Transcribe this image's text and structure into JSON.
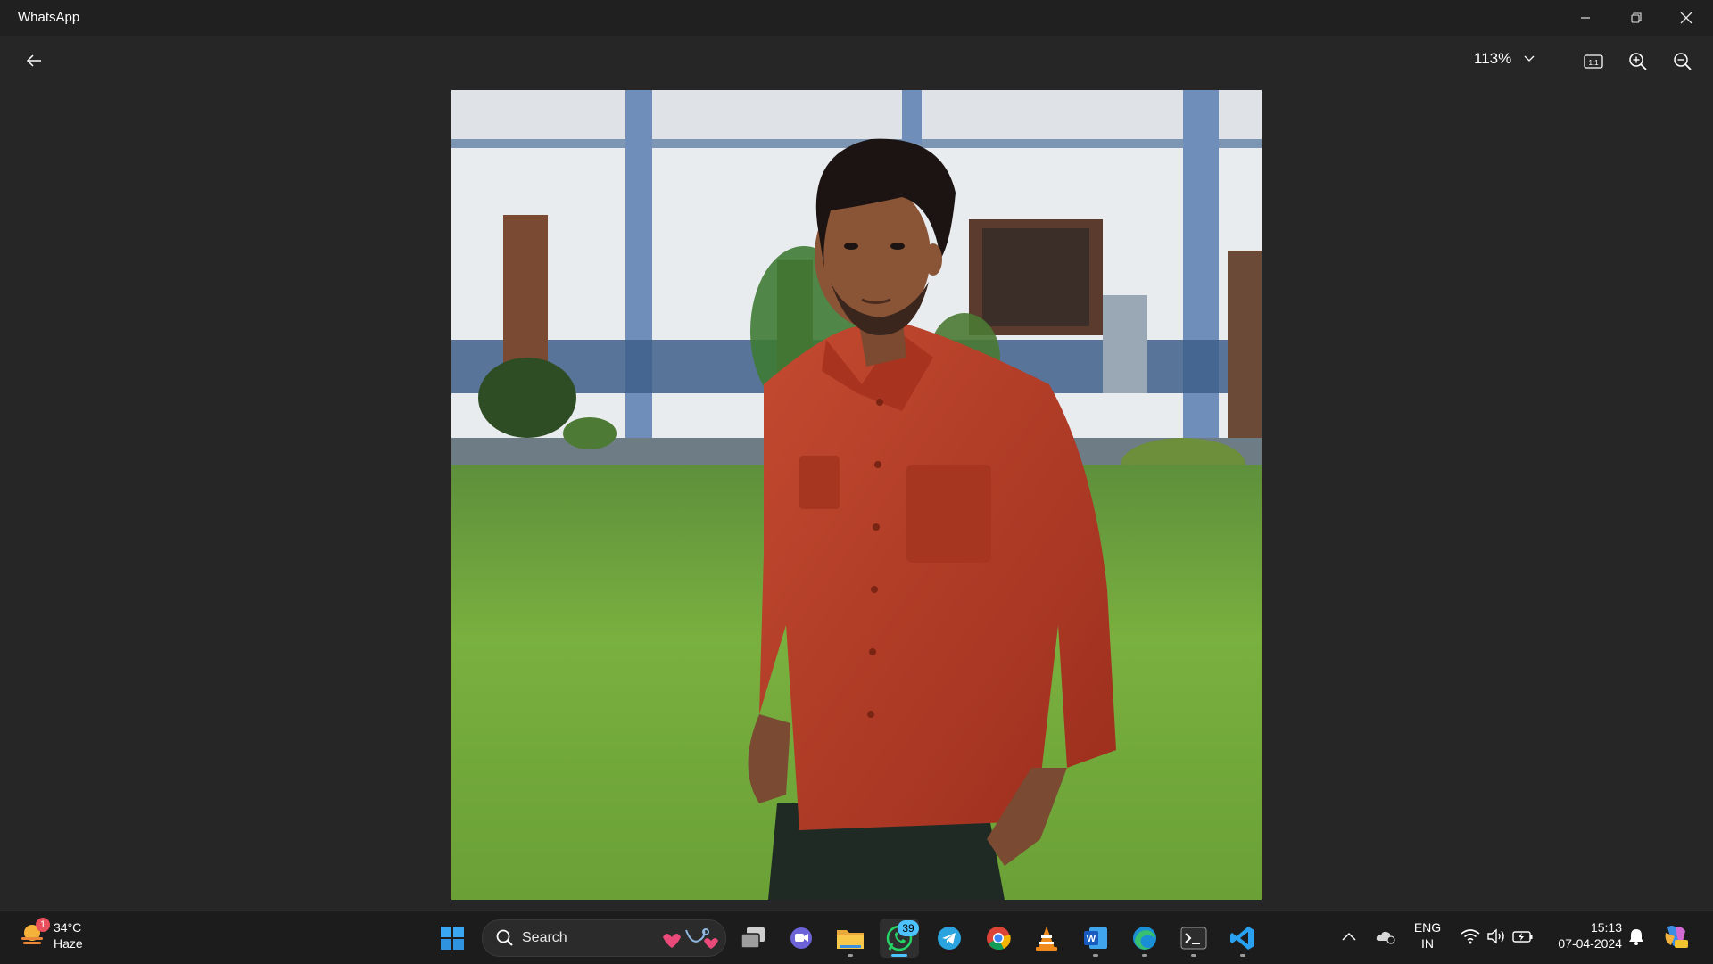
{
  "window": {
    "title": "WhatsApp",
    "controls": [
      "minimize",
      "restore",
      "close"
    ]
  },
  "viewer": {
    "zoom": "113%",
    "buttons": [
      "back",
      "zoom-dropdown",
      "actual-size",
      "zoom-in",
      "zoom-out"
    ],
    "actual_size_label": "1:1"
  },
  "taskbar": {
    "weather": {
      "temperature": "34°C",
      "condition": "Haze",
      "badge": "1"
    },
    "search_placeholder": "Search",
    "apps": [
      {
        "name": "start",
        "icon": "windows-logo-icon"
      },
      {
        "name": "task-view",
        "icon": "task-view-icon"
      },
      {
        "name": "teams-chat",
        "icon": "chat-icon"
      },
      {
        "name": "file-explorer",
        "icon": "folder-icon"
      },
      {
        "name": "whatsapp",
        "icon": "whatsapp-icon",
        "badge": "39",
        "active": true
      },
      {
        "name": "telegram",
        "icon": "telegram-icon"
      },
      {
        "name": "chrome",
        "icon": "chrome-icon"
      },
      {
        "name": "vlc",
        "icon": "vlc-cone-icon"
      },
      {
        "name": "word",
        "icon": "word-icon"
      },
      {
        "name": "edge",
        "icon": "edge-icon"
      },
      {
        "name": "terminal",
        "icon": "terminal-icon"
      },
      {
        "name": "vscode",
        "icon": "vscode-icon"
      }
    ],
    "tray": {
      "language_line1": "ENG",
      "language_line2": "IN",
      "time": "15:13",
      "date": "07-04-2024"
    }
  },
  "colors": {
    "window_bg": "#262626",
    "titlebar_bg": "#202020",
    "taskbar_bg": "#1c1c1c",
    "accent": "#4cc2ff",
    "shirt": "#b33a25",
    "grass": "#6aa63a"
  }
}
